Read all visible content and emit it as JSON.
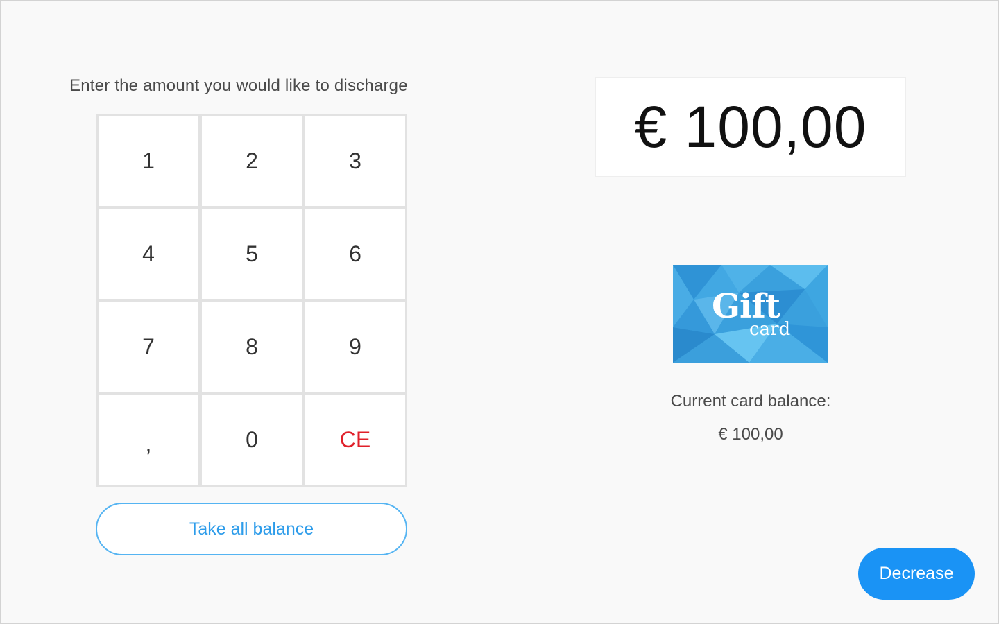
{
  "prompt": "Enter the amount you would like to discharge",
  "keypad": {
    "keys": [
      {
        "label": "1"
      },
      {
        "label": "2"
      },
      {
        "label": "3"
      },
      {
        "label": "4"
      },
      {
        "label": "5"
      },
      {
        "label": "6"
      },
      {
        "label": "7"
      },
      {
        "label": "8"
      },
      {
        "label": "9"
      },
      {
        "label": ","
      },
      {
        "label": "0"
      },
      {
        "label": "CE"
      }
    ],
    "ce_color": "#e0202a"
  },
  "take_all_label": "Take all balance",
  "amount_display": "€ 100,00",
  "gift_card": {
    "title": "Gift",
    "subtitle": "card"
  },
  "balance": {
    "label": "Current card balance:",
    "value": "€ 100,00"
  },
  "decrease_label": "Decrease",
  "colors": {
    "accent": "#1a93f5",
    "outline": "#55b4f2",
    "background": "#f9f9f9"
  }
}
